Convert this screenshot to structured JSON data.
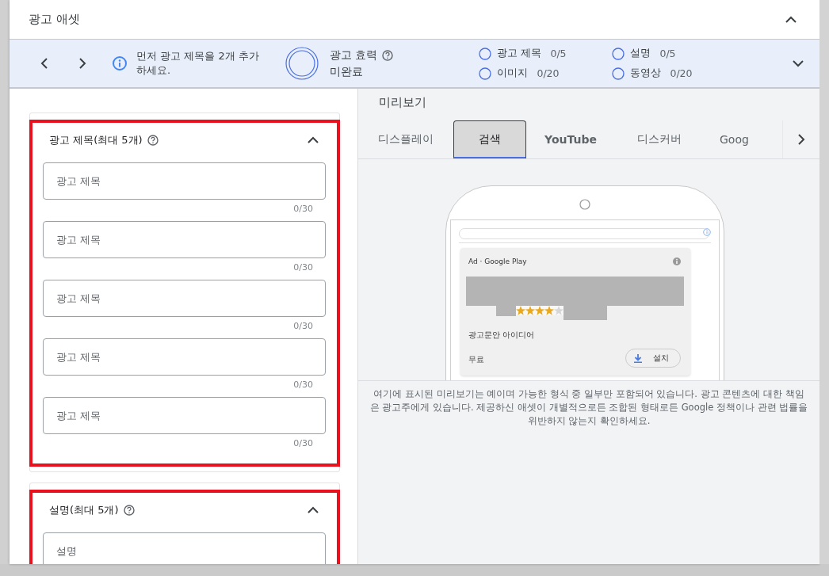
{
  "header": {
    "title": "광고 애셋",
    "expanded": true
  },
  "summary": {
    "message": "먼저 광고 제목을 2개 추가하세요.",
    "strength_label": "광고 효력",
    "strength_value": "미완료",
    "requirements": [
      {
        "label": "광고 제목",
        "count": "0/5",
        "done": false
      },
      {
        "label": "설명",
        "count": "0/5",
        "done": false
      },
      {
        "label": "이미지",
        "count": "0/20",
        "done": false
      },
      {
        "label": "동영상",
        "count": "0/20",
        "done": false
      }
    ]
  },
  "sections": [
    {
      "title": "광고 제목(최대 5개)",
      "expanded": true,
      "highlighted": true,
      "fields": [
        {
          "placeholder": "광고 제목",
          "counter": "0/30"
        },
        {
          "placeholder": "광고 제목",
          "counter": "0/30"
        },
        {
          "placeholder": "광고 제목",
          "counter": "0/30"
        },
        {
          "placeholder": "광고 제목",
          "counter": "0/30"
        },
        {
          "placeholder": "광고 제목",
          "counter": "0/30"
        }
      ]
    },
    {
      "title": "설명(최대 5개)",
      "expanded": true,
      "highlighted": true,
      "fields": [
        {
          "placeholder": "설명"
        }
      ]
    }
  ],
  "preview": {
    "title": "미리보기",
    "tabs": [
      {
        "label": "디스플레이",
        "selected": false
      },
      {
        "label": "검색",
        "selected": true
      },
      {
        "label": "YouTube",
        "selected": false
      },
      {
        "label": "디스커버",
        "selected": false
      },
      {
        "label": "Goog",
        "selected": false
      }
    ],
    "ad": {
      "source": "Ad · Google Play",
      "stars": 4,
      "headline": "광고문안 아이디어",
      "price": "무료",
      "button": "설치"
    },
    "disclaimer": "여기에 표시된 미리보기는 예이며 가능한 형식 중 일부만 포함되어 있습니다. 광고 콘텐츠에 대한 책임은 광고주에게 있습니다. 제공하신 애셋이 개별적으로든 조합된 형태로든 Google 정책이나 관련 법률을 위반하지 않는지 확인하세요."
  }
}
